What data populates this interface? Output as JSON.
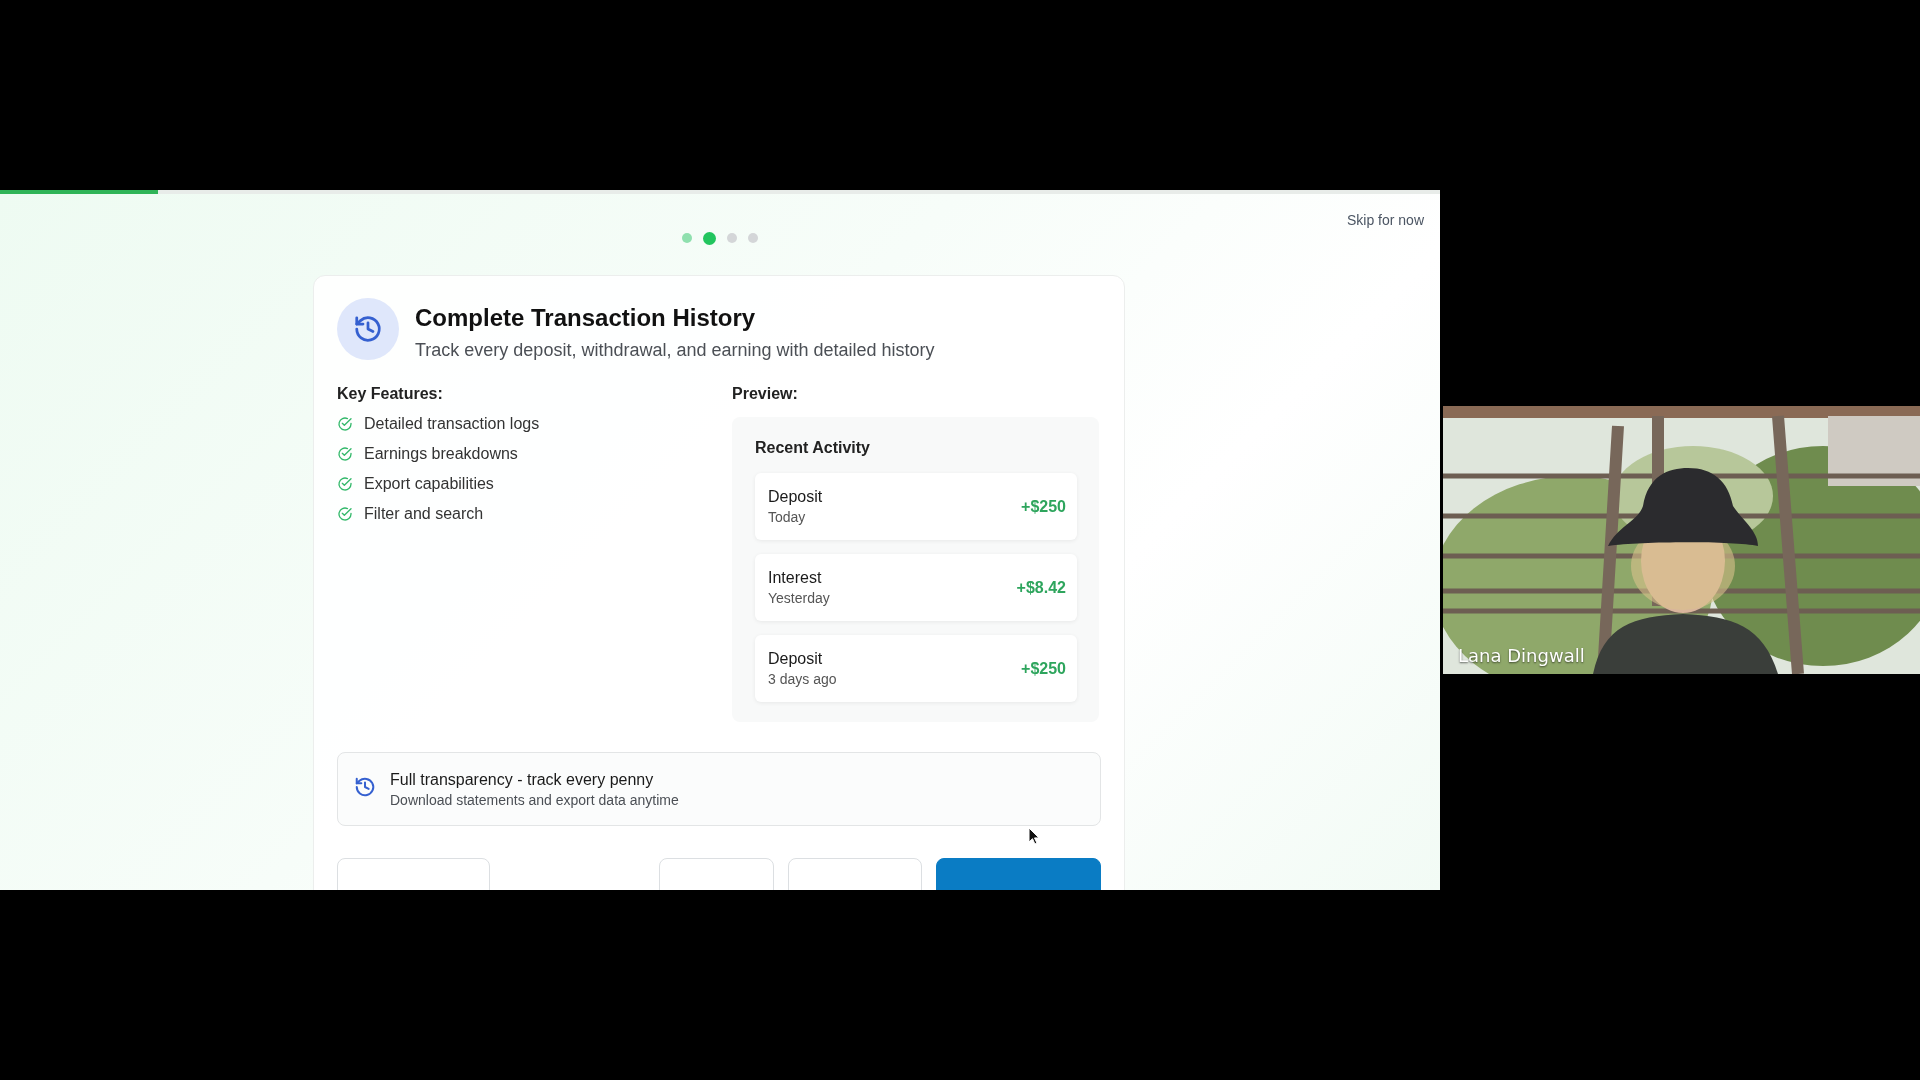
{
  "progress": {
    "level": 0.11
  },
  "steps": [
    {
      "selected": false,
      "completed": true
    },
    {
      "selected": true,
      "completed": false
    },
    {
      "selected": false,
      "completed": false
    },
    {
      "selected": false,
      "completed": false
    }
  ],
  "skip_link": "Skip for now",
  "feature": {
    "title": "Complete Transaction History",
    "subtitle": "Track every deposit, withdrawal, and earning with detailed history"
  },
  "key_features": {
    "heading": "Key Features:",
    "items": [
      "Detailed transaction logs",
      "Earnings breakdowns",
      "Export capabilities",
      "Filter and search"
    ]
  },
  "preview": {
    "heading": "Preview:",
    "panel_title": "Recent Activity",
    "transactions": [
      {
        "type": "Deposit",
        "when": "Today",
        "amount": "+$250"
      },
      {
        "type": "Interest",
        "when": "Yesterday",
        "amount": "+$8.42"
      },
      {
        "type": "Deposit",
        "when": "3 days ago",
        "amount": "+$250"
      }
    ]
  },
  "callout": {
    "title": "Full transparency - track every penny",
    "text": "Download statements and export data anytime"
  },
  "footer_buttons": [
    {
      "kind": "outline"
    },
    {
      "kind": "outline"
    },
    {
      "kind": "outline"
    },
    {
      "kind": "primary"
    }
  ],
  "video": {
    "kind": "picture",
    "participant": "Lana Dingwall"
  }
}
